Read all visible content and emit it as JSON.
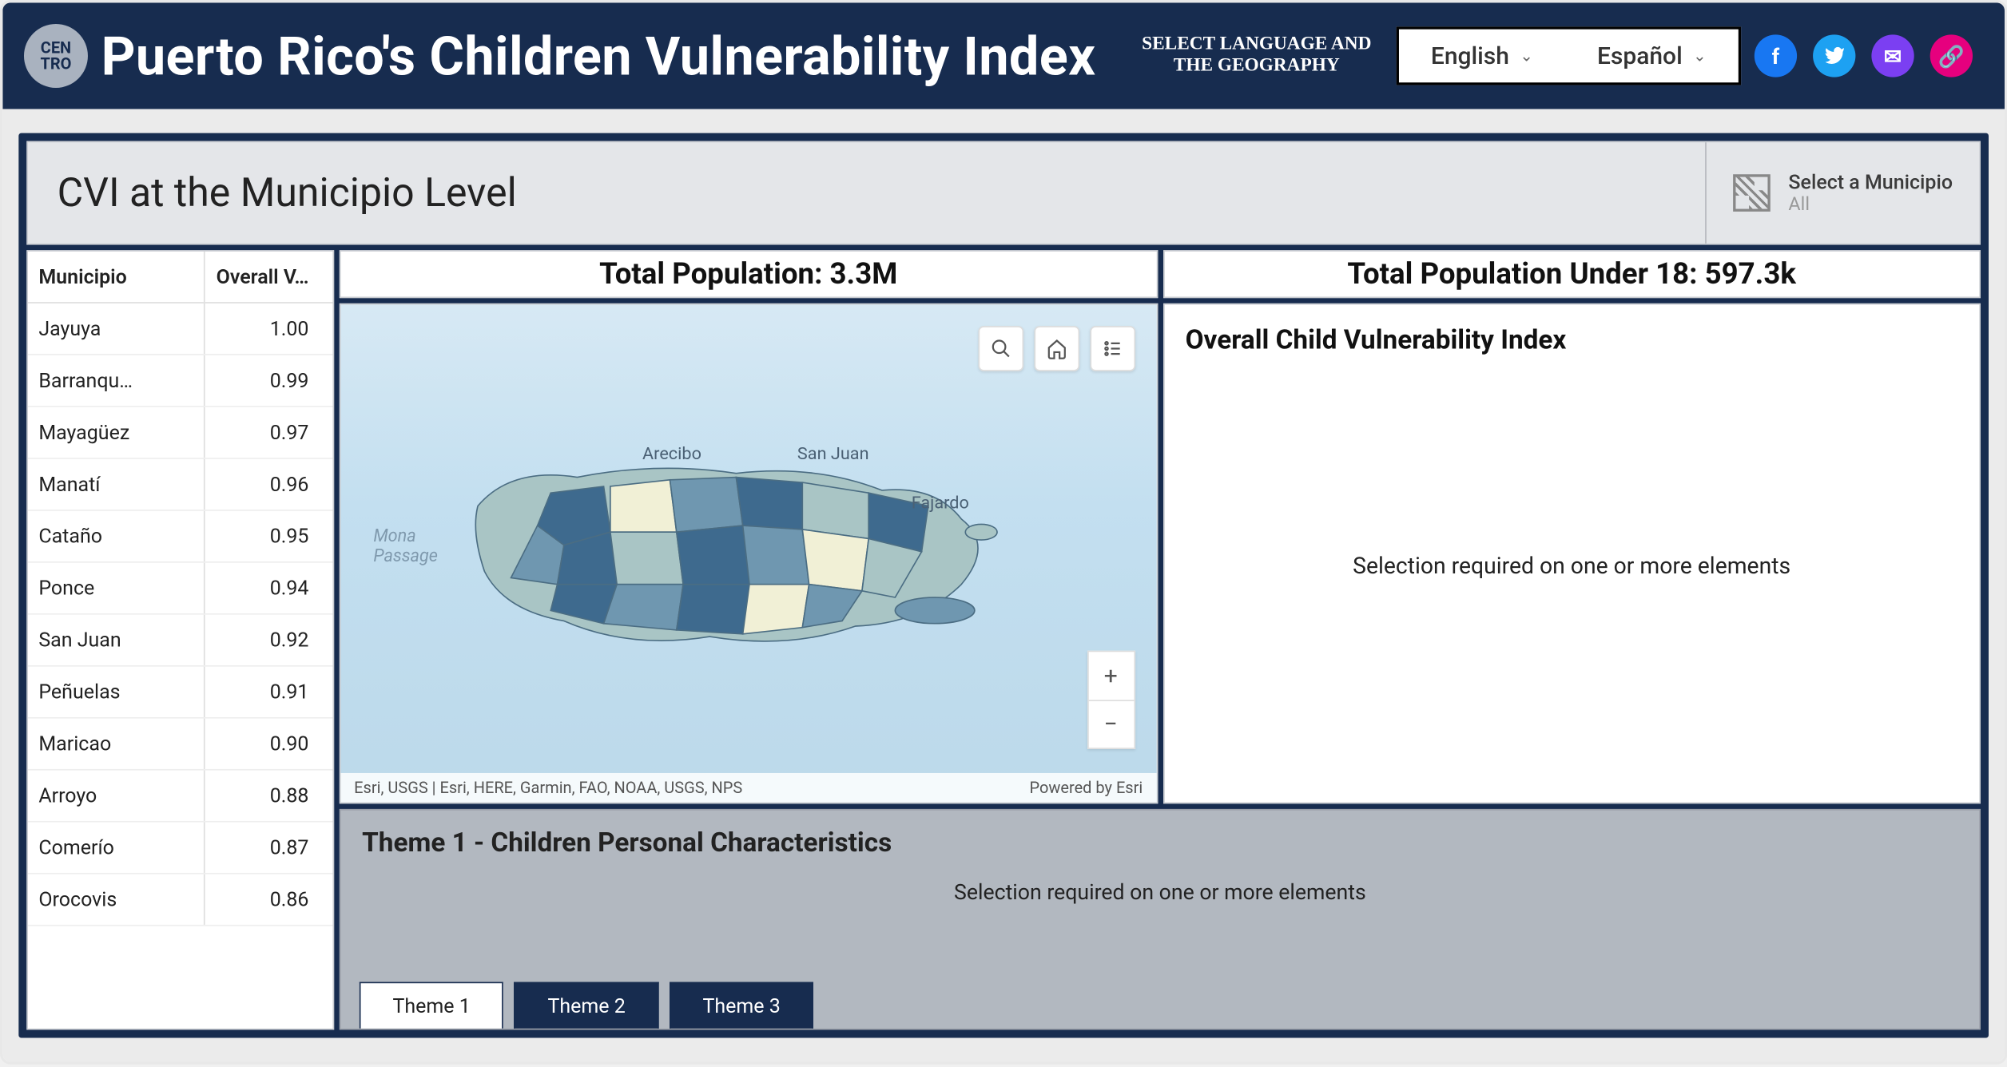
{
  "header": {
    "logo_text": "CEN\nTRO",
    "title": "Puerto Rico's Children Vulnerability Index",
    "lang_note": "SELECT LANGUAGE AND THE GEOGRAPHY",
    "languages": [
      "English",
      "Español"
    ],
    "social": {
      "facebook": "f",
      "twitter": "",
      "email": "✉",
      "link": "🔗"
    }
  },
  "dashboard": {
    "title": "CVI at the Municipio Level",
    "selector": {
      "label": "Select a Municipio",
      "value": "All"
    }
  },
  "table": {
    "col_name": "Municipio",
    "col_val": "Overall V…",
    "rows": [
      {
        "name": "Jayuya",
        "val": "1.00"
      },
      {
        "name": "Barranqu…",
        "val": "0.99"
      },
      {
        "name": "Mayagüez",
        "val": "0.97"
      },
      {
        "name": "Manatí",
        "val": "0.96"
      },
      {
        "name": "Cataño",
        "val": "0.95"
      },
      {
        "name": "Ponce",
        "val": "0.94"
      },
      {
        "name": "San Juan",
        "val": "0.92"
      },
      {
        "name": "Peñuelas",
        "val": "0.91"
      },
      {
        "name": "Maricao",
        "val": "0.90"
      },
      {
        "name": "Arroyo",
        "val": "0.88"
      },
      {
        "name": "Comerío",
        "val": "0.87"
      },
      {
        "name": "Orocovis",
        "val": "0.86"
      }
    ]
  },
  "stats": {
    "total_pop": "Total Population: 3.3M",
    "under18": "Total Population Under 18: 597.3k"
  },
  "map": {
    "labels": {
      "arecibo": "Arecibo",
      "sanjuan": "San Juan",
      "fajardo": "Fajardo",
      "mona": "Mona\nPassage"
    },
    "attribution": "Esri, USGS | Esri, HERE, Garmin, FAO, NOAA, USGS, NPS",
    "powered": "Powered by Esri",
    "colors": {
      "low": "#f1f0d6",
      "mid": "#a9c5c5",
      "high": "#6f97b0",
      "highest": "#3e6a8e"
    }
  },
  "chart": {
    "title": "Overall Child Vulnerability Index",
    "msg": "Selection required on one or more elements"
  },
  "theme": {
    "title": "Theme 1 - Children Personal Characteristics",
    "msg": "Selection required on one or more elements",
    "tabs": [
      "Theme 1",
      "Theme 2",
      "Theme 3"
    ],
    "active_tab": 0
  }
}
